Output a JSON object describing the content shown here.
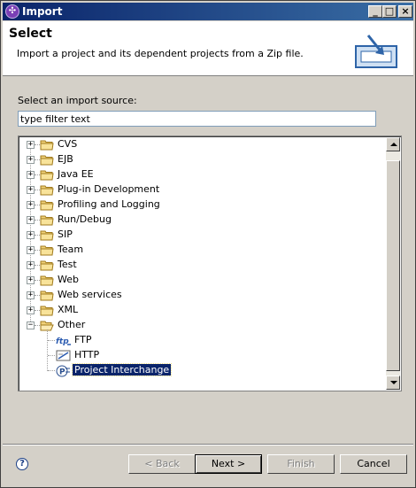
{
  "window": {
    "title": "Import"
  },
  "header": {
    "title": "Select",
    "description": "Import a project and its dependent projects from a Zip file."
  },
  "source": {
    "label": "Select an import source:",
    "filter_placeholder": "type filter text",
    "filter_value": "type filter text"
  },
  "tree": {
    "items": [
      {
        "label": "CVS",
        "icon": "folder-icon",
        "expanded": false
      },
      {
        "label": "EJB",
        "icon": "folder-icon",
        "expanded": false
      },
      {
        "label": "Java EE",
        "icon": "folder-icon",
        "expanded": false
      },
      {
        "label": "Plug-in Development",
        "icon": "folder-icon",
        "expanded": false
      },
      {
        "label": "Profiling and Logging",
        "icon": "folder-icon",
        "expanded": false
      },
      {
        "label": "Run/Debug",
        "icon": "folder-icon",
        "expanded": false
      },
      {
        "label": "SIP",
        "icon": "folder-icon",
        "expanded": false
      },
      {
        "label": "Team",
        "icon": "folder-icon",
        "expanded": false
      },
      {
        "label": "Test",
        "icon": "folder-icon",
        "expanded": false
      },
      {
        "label": "Web",
        "icon": "folder-icon",
        "expanded": false
      },
      {
        "label": "Web services",
        "icon": "folder-icon",
        "expanded": false
      },
      {
        "label": "XML",
        "icon": "folder-icon",
        "expanded": false
      },
      {
        "label": "Other",
        "icon": "folder-open-icon",
        "expanded": true
      }
    ],
    "children": [
      {
        "label": "FTP",
        "icon": "ftp-icon",
        "selected": false
      },
      {
        "label": "HTTP",
        "icon": "http-icon",
        "selected": false
      },
      {
        "label": "Project Interchange",
        "icon": "project-interchange-icon",
        "selected": true
      }
    ]
  },
  "buttons": {
    "back": "< Back",
    "next": "Next >",
    "finish": "Finish",
    "cancel": "Cancel"
  },
  "colors": {
    "titlebar_start": "#0a246a",
    "titlebar_end": "#3a6ea5",
    "selection": "#0a246a",
    "dialog_bg": "#d4d0c8"
  }
}
